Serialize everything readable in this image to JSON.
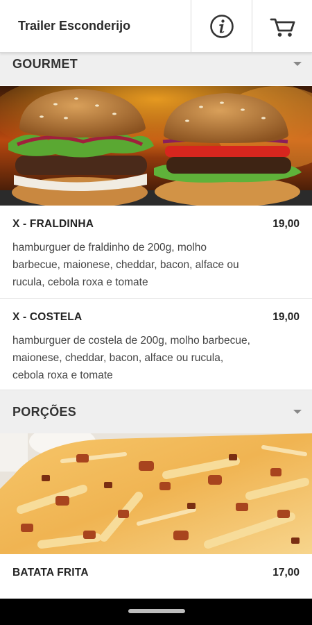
{
  "header": {
    "title": "Trailer Esconderijo",
    "info_icon": "info-icon",
    "cart_icon": "cart-icon"
  },
  "categories": [
    {
      "title": "GOURMET",
      "image": "burger-photo",
      "items": [
        {
          "name": "X - FRALDINHA",
          "price": "19,00",
          "description": "hamburguer de fraldinho de 200g, molho barbecue, maionese, cheddar, bacon, alface ou rucula, cebola roxa e tomate"
        },
        {
          "name": "X - COSTELA",
          "price": "19,00",
          "description": "hamburguer de costela de 200g, molho barbecue, maionese, cheddar, bacon, alface ou rucula, cebola roxa e tomate"
        }
      ]
    },
    {
      "title": "PORÇÕES",
      "image": "fries-photo",
      "items": [
        {
          "name": "BATATA FRITA",
          "price": "17,00"
        }
      ]
    }
  ],
  "colors": {
    "header_bg": "#ffffff",
    "category_bg": "#efefef",
    "text": "#222222",
    "nav_bar": "#000000"
  }
}
